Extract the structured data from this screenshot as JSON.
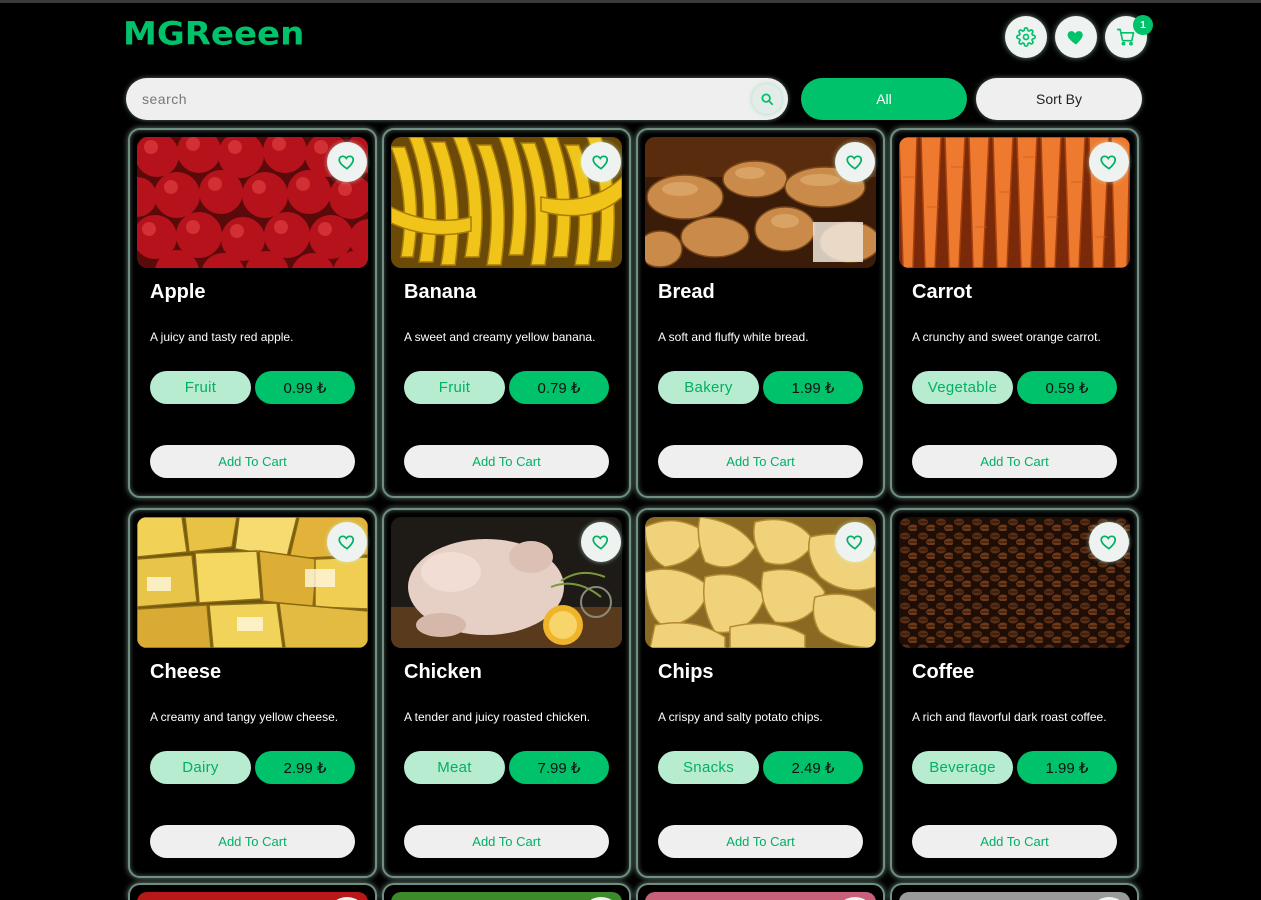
{
  "header": {
    "logo": "MGReeen",
    "cart_count": "1",
    "icons": [
      "gear-icon",
      "heart-icon",
      "cart-icon"
    ]
  },
  "search": {
    "placeholder": "search",
    "value": ""
  },
  "filters": {
    "all_label": "All",
    "sort_label": "Sort By"
  },
  "colors": {
    "accent": "#00c26b",
    "tag_bg": "#b8ecd1",
    "button_bg": "#efefef"
  },
  "products": [
    {
      "name": "Apple",
      "description": "A juicy and tasty red apple.",
      "category": "Fruit",
      "price": "0.99 ₺",
      "cta": "Add To Cart"
    },
    {
      "name": "Banana",
      "description": "A sweet and creamy yellow banana.",
      "category": "Fruit",
      "price": "0.79 ₺",
      "cta": "Add To Cart"
    },
    {
      "name": "Bread",
      "description": "A soft and fluffy white bread.",
      "category": "Bakery",
      "price": "1.99 ₺",
      "cta": "Add To Cart"
    },
    {
      "name": "Carrot",
      "description": "A crunchy and sweet orange carrot.",
      "category": "Vegetable",
      "price": "0.59 ₺",
      "cta": "Add To Cart"
    },
    {
      "name": "Cheese",
      "description": "A creamy and tangy yellow cheese.",
      "category": "Dairy",
      "price": "2.99 ₺",
      "cta": "Add To Cart"
    },
    {
      "name": "Chicken",
      "description": "A tender and juicy roasted chicken.",
      "category": "Meat",
      "price": "7.99 ₺",
      "cta": "Add To Cart"
    },
    {
      "name": "Chips",
      "description": "A crispy and salty potato chips.",
      "category": "Snacks",
      "price": "2.49 ₺",
      "cta": "Add To Cart"
    },
    {
      "name": "Coffee",
      "description": "A rich and flavorful dark roast coffee.",
      "category": "Beverage",
      "price": "1.99 ₺",
      "cta": "Add To Cart"
    }
  ]
}
